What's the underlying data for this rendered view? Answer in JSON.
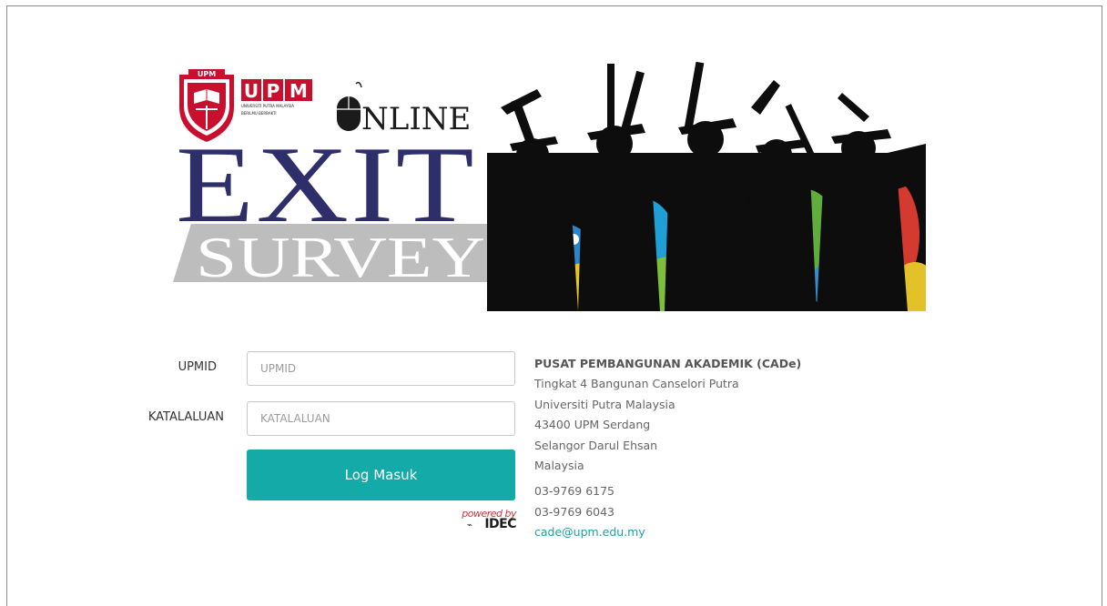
{
  "banner": {
    "logo_acronym": "UPM",
    "logo_subtitle": "UNIVERSITI PUTRA MALAYSIA",
    "logo_motto": "BERILMU BERBAKTI",
    "crest_text": "UPM",
    "title_online": "NLINE",
    "title_exit": "EXIT",
    "title_survey": "SURVEY"
  },
  "form": {
    "upmid_label": "UPMID",
    "upmid_placeholder": "UPMID",
    "upmid_value": "",
    "password_label": "KATALALUAN",
    "password_placeholder": "KATALALUAN",
    "password_value": "",
    "login_label": "Log Masuk"
  },
  "powered": {
    "prefix": "powered by",
    "brand": "IDEC"
  },
  "contact": {
    "organization": "PUSAT PEMBANGUNAN AKADEMIK (CADe)",
    "address_lines": [
      "Tingkat 4 Bangunan Canselori Putra",
      "Universiti Putra Malaysia",
      "43400 UPM Serdang",
      "Selangor Darul Ehsan",
      "Malaysia"
    ],
    "phones": [
      "03-9769 6175",
      "03-9769 6043"
    ],
    "email": "cade@upm.edu.my"
  },
  "colors": {
    "accent": "#14aaa7",
    "upm_red": "#c8102e",
    "title_navy": "#2e2e6a",
    "survey_band": "#bdbdbd"
  }
}
